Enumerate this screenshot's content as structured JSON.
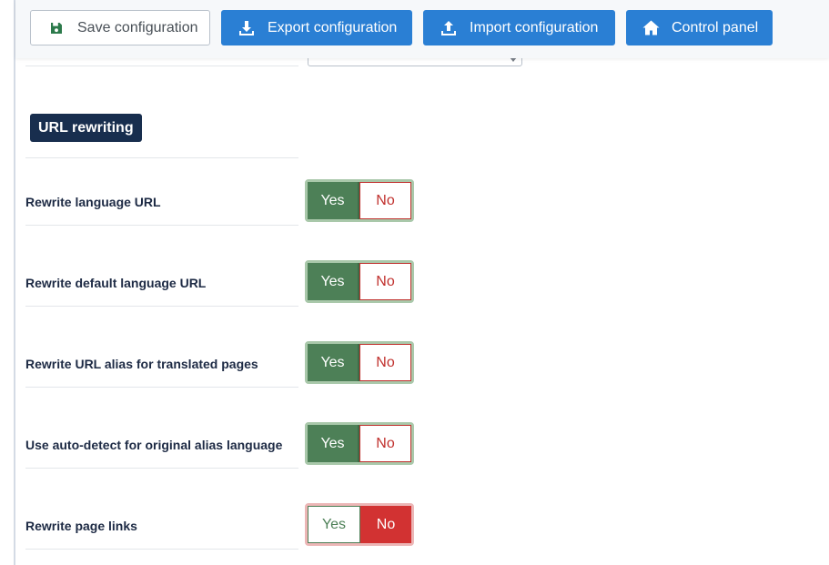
{
  "toolbar": {
    "save_label": "Save configuration",
    "export_label": "Export configuration",
    "import_label": "Import configuration",
    "control_panel_label": "Control panel"
  },
  "section": {
    "title": "URL rewriting"
  },
  "toggle_options": {
    "yes": "Yes",
    "no": "No"
  },
  "settings": [
    {
      "label": "Rewrite language URL",
      "value": "Yes"
    },
    {
      "label": "Rewrite default language URL",
      "value": "Yes"
    },
    {
      "label": "Rewrite URL alias for translated pages",
      "value": "Yes"
    },
    {
      "label": "Use auto-detect for original alias language",
      "value": "Yes"
    },
    {
      "label": "Rewrite page links",
      "value": "No"
    }
  ],
  "colors": {
    "primary_blue": "#2a7fd4",
    "section_navy": "#182e4e",
    "yes_green": "#4d8057",
    "no_red": "#d23232"
  },
  "icons": {
    "save": "floppy-disk-icon",
    "export": "download-icon",
    "import": "upload-icon",
    "control_panel": "home-icon"
  }
}
